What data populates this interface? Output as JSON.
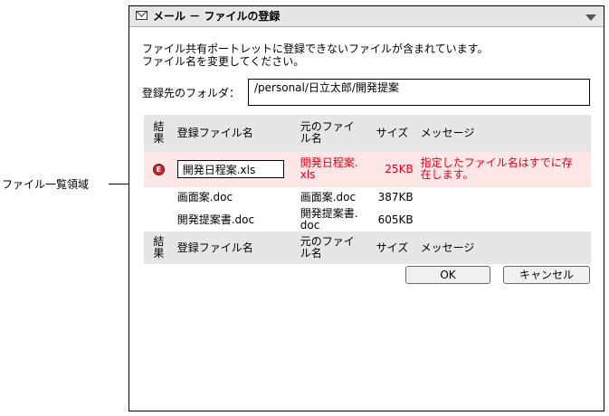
{
  "annotation": {
    "label": "ファイル一覧領域"
  },
  "window": {
    "title": "メール － ファイルの登録"
  },
  "message": {
    "line1": "ファイル共有ポートレットに登録できないファイルが含まれています。",
    "line2": "ファイル名を変更してください。"
  },
  "folder": {
    "label": "登録先のフォルダ：",
    "value": "/personal/日立太郎/開発提案"
  },
  "table": {
    "headers": {
      "result": [
        "結",
        "果"
      ],
      "filename": "登録ファイル名",
      "original": [
        "元のファイ",
        "ル名"
      ],
      "size": "サイズ",
      "message": "メッセージ"
    },
    "rows": [
      {
        "status_icon": "error-icon",
        "status_glyph": "E",
        "filename_input": "開発日程案.xls",
        "original": [
          "開発日程案.",
          "xls"
        ],
        "size": "25KB",
        "message": [
          "指定したファイル名はすでに存",
          "在します。"
        ]
      },
      {
        "filename": "画面案.doc",
        "original": [
          "画面案.doc"
        ],
        "size": "387KB",
        "message": ""
      },
      {
        "filename": "開発提案書.doc",
        "original": [
          "開発提案書.",
          "doc"
        ],
        "size": "605KB",
        "message": ""
      }
    ]
  },
  "buttons": {
    "ok": "OK",
    "cancel": "キャンセル"
  },
  "colors": {
    "error_text": "#e8001c",
    "error_row_bg": "#fde6e6",
    "header_bg": "#e6e6e6"
  }
}
